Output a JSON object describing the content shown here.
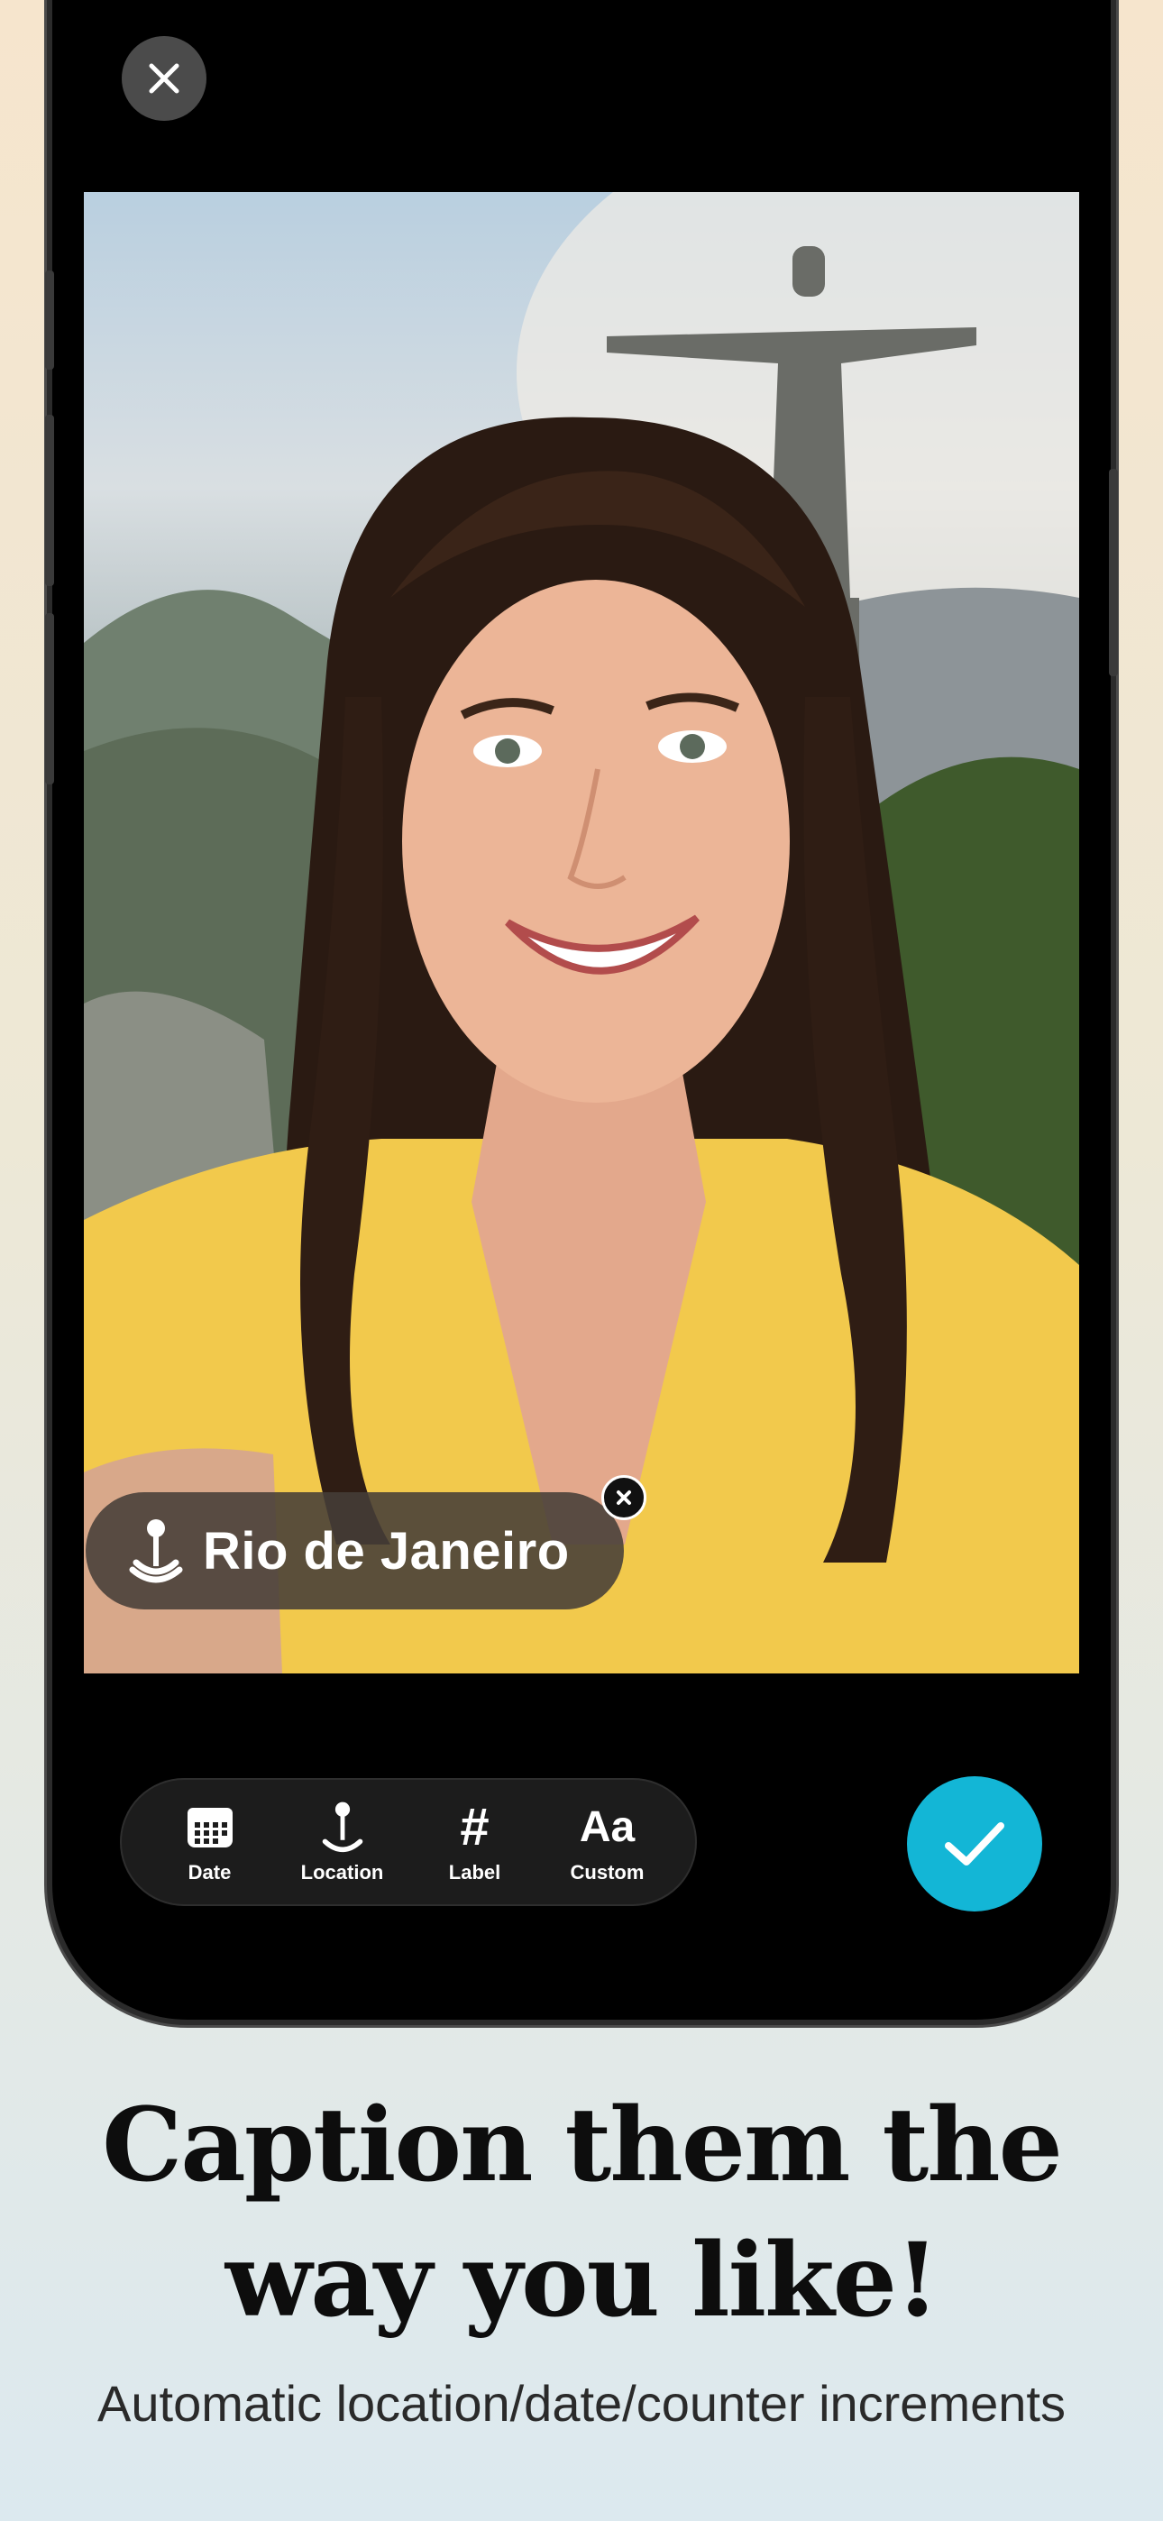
{
  "caption": {
    "text": "Rio de Janeiro"
  },
  "toolbar": {
    "items": [
      {
        "label": "Date",
        "icon": "calendar-icon"
      },
      {
        "label": "Location",
        "icon": "location-pin-icon"
      },
      {
        "label": "Label",
        "icon": "hashtag-icon"
      },
      {
        "label": "Custom",
        "icon": "text-aa-icon"
      }
    ],
    "custom_glyph": "Aa",
    "label_glyph": "#"
  },
  "headline": {
    "line1": "Caption them the",
    "line2": "way you like!"
  },
  "subline": "Automatic location/date/counter increments",
  "colors": {
    "confirm": "#13b6d6",
    "pill": "#463e38"
  }
}
